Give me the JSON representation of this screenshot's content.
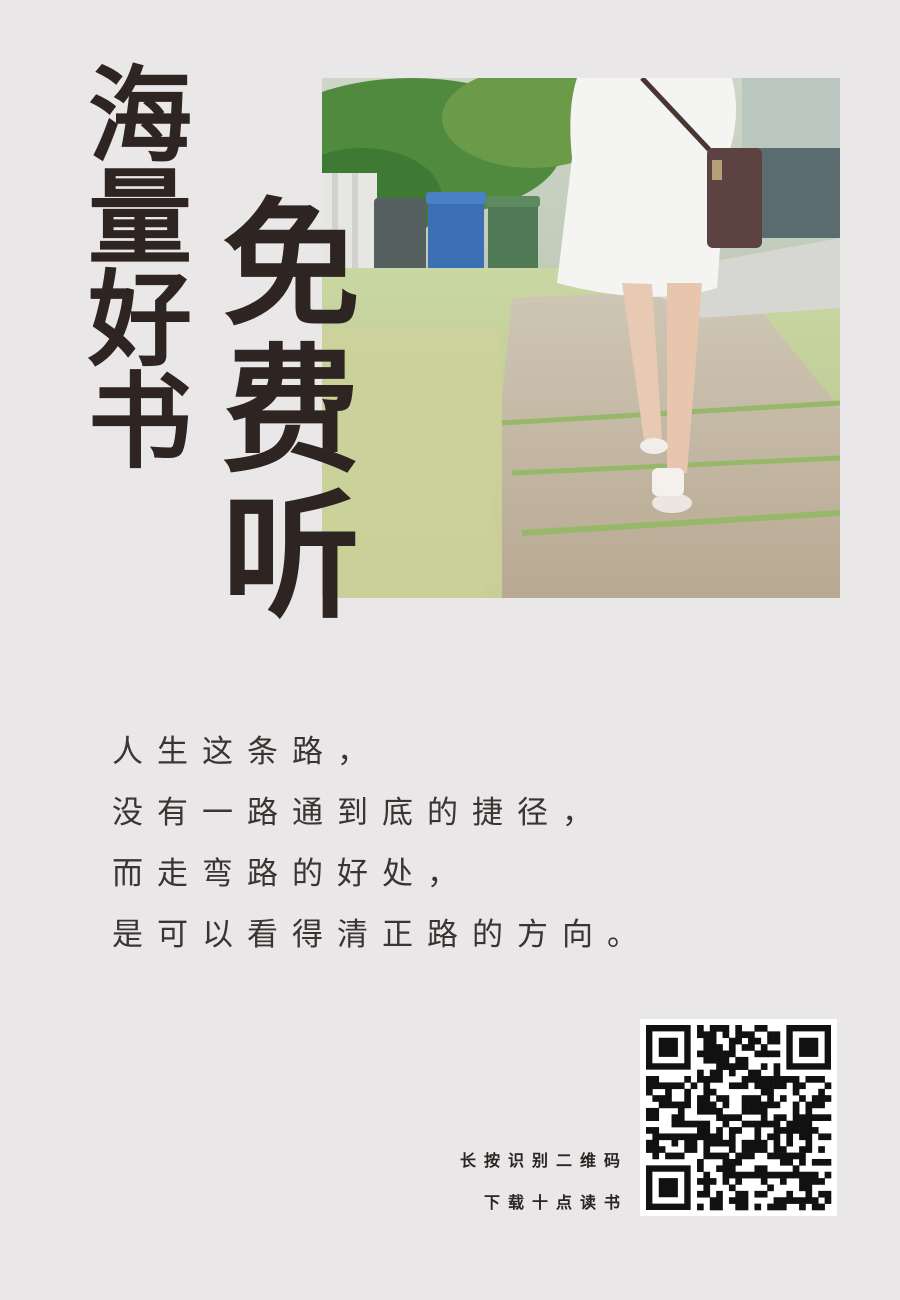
{
  "title": {
    "left_chars": [
      "海",
      "量",
      "好",
      "书"
    ],
    "right_chars": [
      "免",
      "费",
      "听"
    ]
  },
  "poem": {
    "lines": [
      "人生这条路，",
      "没有一路通到底的捷径，",
      "而走弯路的好处，",
      "是可以看得清正路的方向。"
    ]
  },
  "qr_caption": {
    "line1": "长按识别二维码",
    "line2": "下载十点读书"
  },
  "icons": {
    "moon": "crescent-moon-icon",
    "qr": "qr-code"
  },
  "colors": {
    "background": "#e9e7e7",
    "title": "#2e2522",
    "text": "#3a3433"
  }
}
